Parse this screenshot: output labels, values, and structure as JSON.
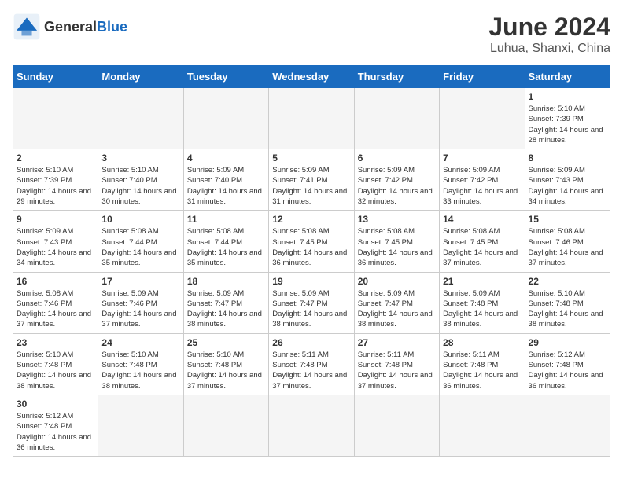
{
  "header": {
    "logo_general": "General",
    "logo_blue": "Blue",
    "month_title": "June 2024",
    "location": "Luhua, Shanxi, China"
  },
  "days_of_week": [
    "Sunday",
    "Monday",
    "Tuesday",
    "Wednesday",
    "Thursday",
    "Friday",
    "Saturday"
  ],
  "weeks": [
    [
      {
        "day": "",
        "empty": true
      },
      {
        "day": "",
        "empty": true
      },
      {
        "day": "",
        "empty": true
      },
      {
        "day": "",
        "empty": true
      },
      {
        "day": "",
        "empty": true
      },
      {
        "day": "",
        "empty": true
      },
      {
        "day": "1",
        "sunrise": "Sunrise: 5:10 AM",
        "sunset": "Sunset: 7:39 PM",
        "daylight": "Daylight: 14 hours and 28 minutes."
      }
    ],
    [
      {
        "day": "2",
        "sunrise": "Sunrise: 5:10 AM",
        "sunset": "Sunset: 7:39 PM",
        "daylight": "Daylight: 14 hours and 29 minutes."
      },
      {
        "day": "3",
        "sunrise": "Sunrise: 5:10 AM",
        "sunset": "Sunset: 7:40 PM",
        "daylight": "Daylight: 14 hours and 30 minutes."
      },
      {
        "day": "4",
        "sunrise": "Sunrise: 5:09 AM",
        "sunset": "Sunset: 7:40 PM",
        "daylight": "Daylight: 14 hours and 31 minutes."
      },
      {
        "day": "5",
        "sunrise": "Sunrise: 5:09 AM",
        "sunset": "Sunset: 7:41 PM",
        "daylight": "Daylight: 14 hours and 31 minutes."
      },
      {
        "day": "6",
        "sunrise": "Sunrise: 5:09 AM",
        "sunset": "Sunset: 7:42 PM",
        "daylight": "Daylight: 14 hours and 32 minutes."
      },
      {
        "day": "7",
        "sunrise": "Sunrise: 5:09 AM",
        "sunset": "Sunset: 7:42 PM",
        "daylight": "Daylight: 14 hours and 33 minutes."
      },
      {
        "day": "8",
        "sunrise": "Sunrise: 5:09 AM",
        "sunset": "Sunset: 7:43 PM",
        "daylight": "Daylight: 14 hours and 34 minutes."
      }
    ],
    [
      {
        "day": "9",
        "sunrise": "Sunrise: 5:09 AM",
        "sunset": "Sunset: 7:43 PM",
        "daylight": "Daylight: 14 hours and 34 minutes."
      },
      {
        "day": "10",
        "sunrise": "Sunrise: 5:08 AM",
        "sunset": "Sunset: 7:44 PM",
        "daylight": "Daylight: 14 hours and 35 minutes."
      },
      {
        "day": "11",
        "sunrise": "Sunrise: 5:08 AM",
        "sunset": "Sunset: 7:44 PM",
        "daylight": "Daylight: 14 hours and 35 minutes."
      },
      {
        "day": "12",
        "sunrise": "Sunrise: 5:08 AM",
        "sunset": "Sunset: 7:45 PM",
        "daylight": "Daylight: 14 hours and 36 minutes."
      },
      {
        "day": "13",
        "sunrise": "Sunrise: 5:08 AM",
        "sunset": "Sunset: 7:45 PM",
        "daylight": "Daylight: 14 hours and 36 minutes."
      },
      {
        "day": "14",
        "sunrise": "Sunrise: 5:08 AM",
        "sunset": "Sunset: 7:45 PM",
        "daylight": "Daylight: 14 hours and 37 minutes."
      },
      {
        "day": "15",
        "sunrise": "Sunrise: 5:08 AM",
        "sunset": "Sunset: 7:46 PM",
        "daylight": "Daylight: 14 hours and 37 minutes."
      }
    ],
    [
      {
        "day": "16",
        "sunrise": "Sunrise: 5:08 AM",
        "sunset": "Sunset: 7:46 PM",
        "daylight": "Daylight: 14 hours and 37 minutes."
      },
      {
        "day": "17",
        "sunrise": "Sunrise: 5:09 AM",
        "sunset": "Sunset: 7:46 PM",
        "daylight": "Daylight: 14 hours and 37 minutes."
      },
      {
        "day": "18",
        "sunrise": "Sunrise: 5:09 AM",
        "sunset": "Sunset: 7:47 PM",
        "daylight": "Daylight: 14 hours and 38 minutes."
      },
      {
        "day": "19",
        "sunrise": "Sunrise: 5:09 AM",
        "sunset": "Sunset: 7:47 PM",
        "daylight": "Daylight: 14 hours and 38 minutes."
      },
      {
        "day": "20",
        "sunrise": "Sunrise: 5:09 AM",
        "sunset": "Sunset: 7:47 PM",
        "daylight": "Daylight: 14 hours and 38 minutes."
      },
      {
        "day": "21",
        "sunrise": "Sunrise: 5:09 AM",
        "sunset": "Sunset: 7:48 PM",
        "daylight": "Daylight: 14 hours and 38 minutes."
      },
      {
        "day": "22",
        "sunrise": "Sunrise: 5:10 AM",
        "sunset": "Sunset: 7:48 PM",
        "daylight": "Daylight: 14 hours and 38 minutes."
      }
    ],
    [
      {
        "day": "23",
        "sunrise": "Sunrise: 5:10 AM",
        "sunset": "Sunset: 7:48 PM",
        "daylight": "Daylight: 14 hours and 38 minutes."
      },
      {
        "day": "24",
        "sunrise": "Sunrise: 5:10 AM",
        "sunset": "Sunset: 7:48 PM",
        "daylight": "Daylight: 14 hours and 38 minutes."
      },
      {
        "day": "25",
        "sunrise": "Sunrise: 5:10 AM",
        "sunset": "Sunset: 7:48 PM",
        "daylight": "Daylight: 14 hours and 37 minutes."
      },
      {
        "day": "26",
        "sunrise": "Sunrise: 5:11 AM",
        "sunset": "Sunset: 7:48 PM",
        "daylight": "Daylight: 14 hours and 37 minutes."
      },
      {
        "day": "27",
        "sunrise": "Sunrise: 5:11 AM",
        "sunset": "Sunset: 7:48 PM",
        "daylight": "Daylight: 14 hours and 37 minutes."
      },
      {
        "day": "28",
        "sunrise": "Sunrise: 5:11 AM",
        "sunset": "Sunset: 7:48 PM",
        "daylight": "Daylight: 14 hours and 36 minutes."
      },
      {
        "day": "29",
        "sunrise": "Sunrise: 5:12 AM",
        "sunset": "Sunset: 7:48 PM",
        "daylight": "Daylight: 14 hours and 36 minutes."
      }
    ],
    [
      {
        "day": "30",
        "sunrise": "Sunrise: 5:12 AM",
        "sunset": "Sunset: 7:48 PM",
        "daylight": "Daylight: 14 hours and 36 minutes."
      },
      {
        "day": "",
        "empty": true
      },
      {
        "day": "",
        "empty": true
      },
      {
        "day": "",
        "empty": true
      },
      {
        "day": "",
        "empty": true
      },
      {
        "day": "",
        "empty": true
      },
      {
        "day": "",
        "empty": true
      }
    ]
  ]
}
